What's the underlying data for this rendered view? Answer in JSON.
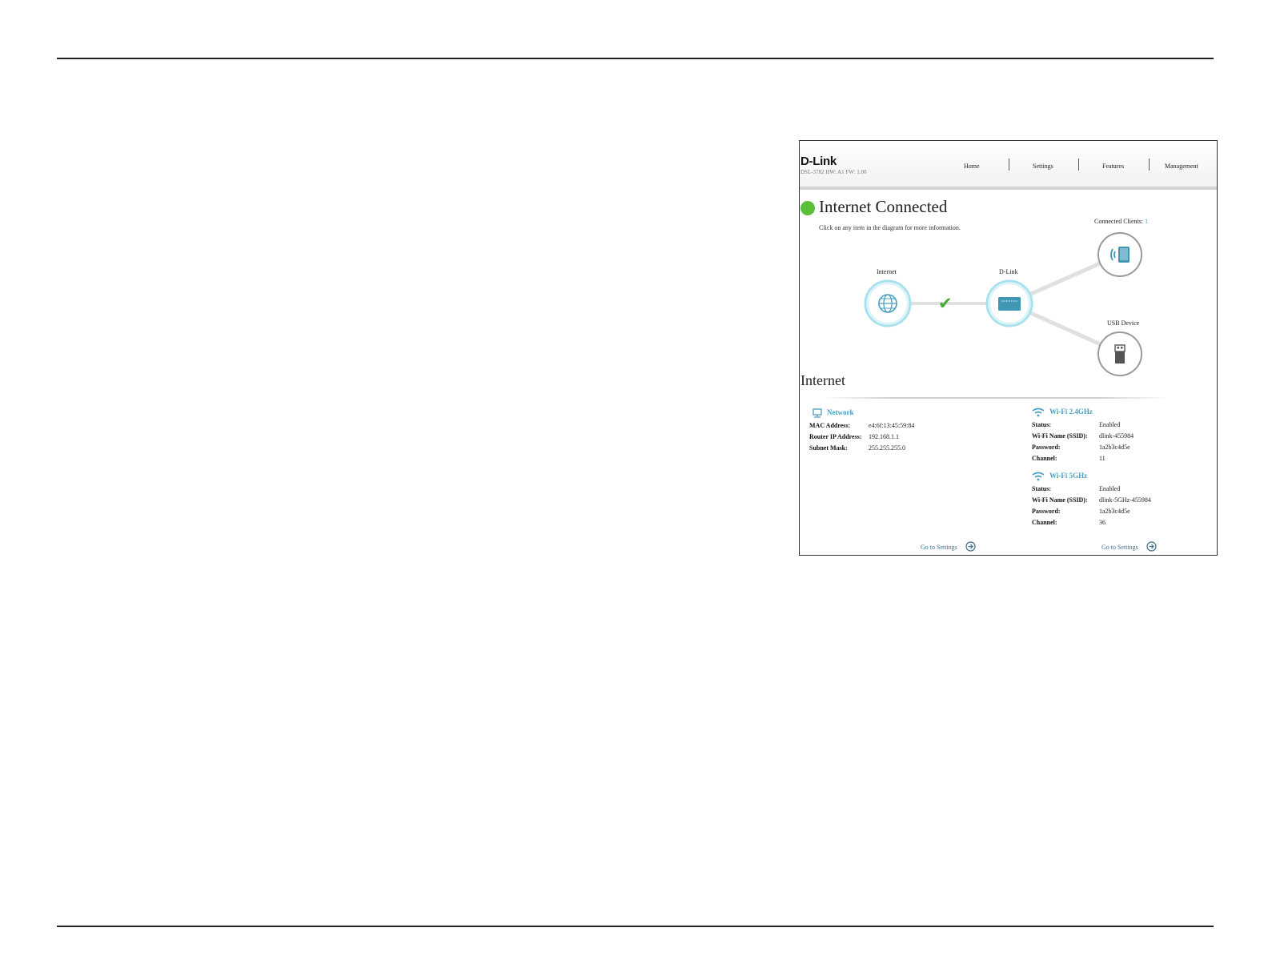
{
  "header": {
    "brand": "D-Link",
    "model_info": "DSL-3782  HW: A1  FW: 1.00",
    "nav": [
      "Home",
      "Settings",
      "Features",
      "Management"
    ]
  },
  "status": {
    "title": "Internet Connected",
    "hint": "Click on any item in the diagram for more information.",
    "clients_label": "Connected Clients:",
    "clients_count": "1"
  },
  "diagram": {
    "internet_label": "Internet",
    "router_label": "D-Link",
    "usb_label": "USB Device"
  },
  "section": {
    "title": "Internet"
  },
  "network": {
    "title": "Network",
    "rows": [
      {
        "label": "MAC Address:",
        "value": "e4:6f:13:45:59:84"
      },
      {
        "label": "Router IP Address:",
        "value": "192.168.1.1"
      },
      {
        "label": "Subnet Mask:",
        "value": "255.255.255.0"
      }
    ]
  },
  "wifi24": {
    "title": "Wi-Fi 2.4GHz",
    "rows": [
      {
        "label": "Status:",
        "value": "Enabled"
      },
      {
        "label": "Wi-Fi Name (SSID):",
        "value": "dlink-455984"
      },
      {
        "label": "Password:",
        "value": "1a2b3c4d5e"
      },
      {
        "label": "Channel:",
        "value": "11"
      }
    ]
  },
  "wifi5": {
    "title": "Wi-Fi 5GHz",
    "rows": [
      {
        "label": "Status:",
        "value": "Enabled"
      },
      {
        "label": "Wi-Fi Name (SSID):",
        "value": "dlink-5GHz-455984"
      },
      {
        "label": "Password:",
        "value": "1a2b3c4d5e"
      },
      {
        "label": "Channel:",
        "value": "36"
      }
    ]
  },
  "links": {
    "goto_settings": "Go to Settings"
  },
  "colors": {
    "accent": "#4a9fc0",
    "connected": "#5bbf3a",
    "node_ring": "#a8e1ee"
  }
}
